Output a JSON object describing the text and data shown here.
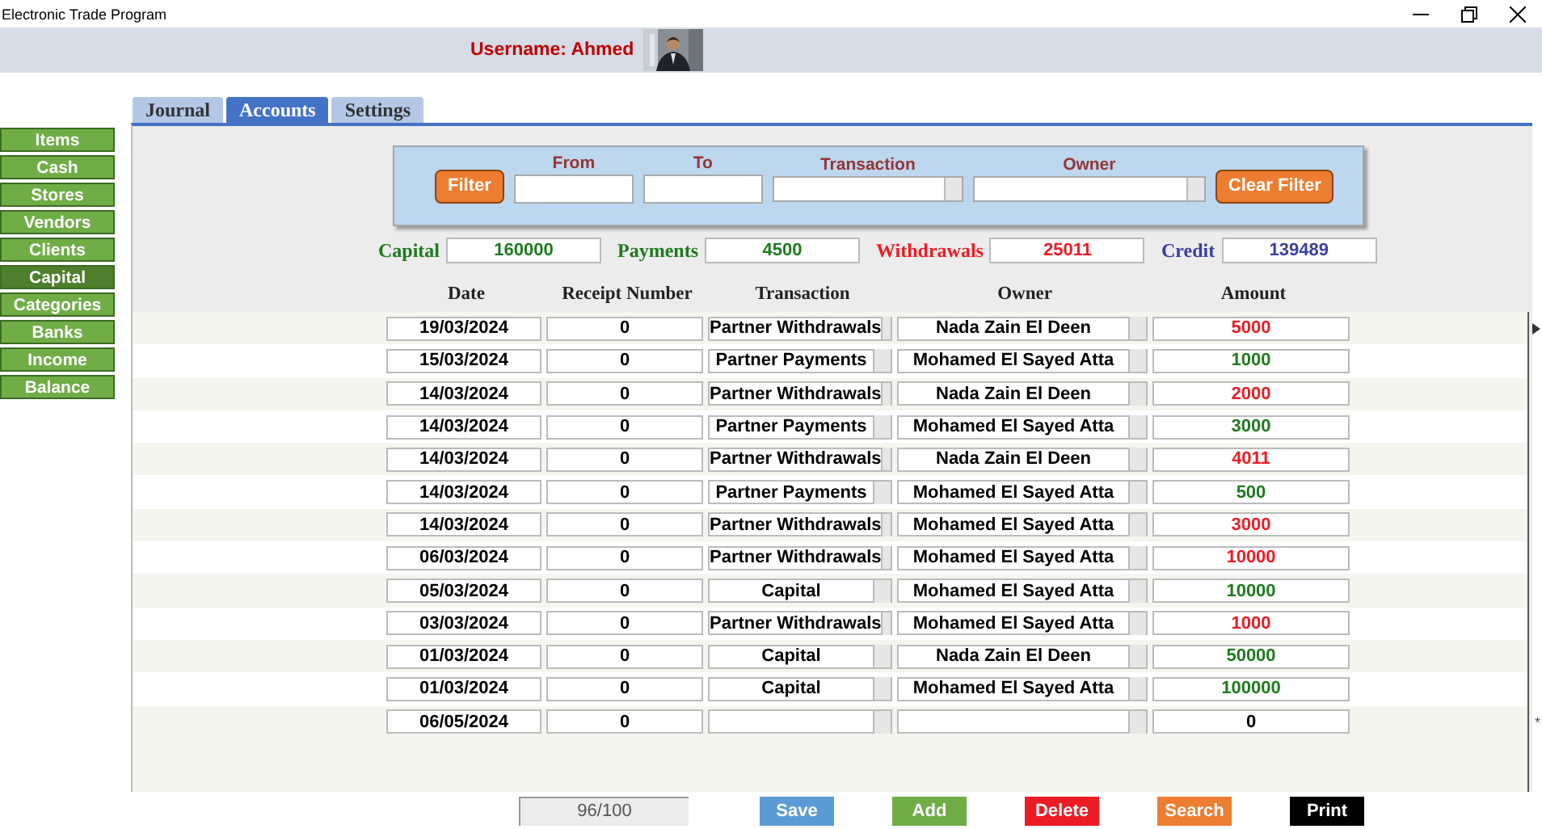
{
  "window": {
    "title": "Electronic Trade Program"
  },
  "header": {
    "username": "Username: Ahmed"
  },
  "sidebar": {
    "items": [
      {
        "label": "Items",
        "selected": false
      },
      {
        "label": "Cash",
        "selected": false
      },
      {
        "label": "Stores",
        "selected": false
      },
      {
        "label": "Vendors",
        "selected": false
      },
      {
        "label": "Clients",
        "selected": false
      },
      {
        "label": "Capital",
        "selected": true
      },
      {
        "label": "Categories",
        "selected": false
      },
      {
        "label": "Banks",
        "selected": false
      },
      {
        "label": "Income",
        "selected": false
      },
      {
        "label": "Balance",
        "selected": false
      }
    ]
  },
  "tabs": [
    {
      "label": "Journal",
      "selected": false
    },
    {
      "label": "Accounts",
      "selected": true
    },
    {
      "label": "Settings",
      "selected": false
    }
  ],
  "filter": {
    "filter_button": "Filter",
    "from_label": "From",
    "to_label": "To",
    "transaction_label": "Transaction",
    "owner_label": "Owner",
    "clear_button": "Clear Filter"
  },
  "summary": [
    {
      "label": "Capital",
      "value": "160000",
      "kind": "positive"
    },
    {
      "label": "Payments",
      "value": "4500",
      "kind": "positive"
    },
    {
      "label": "Withdrawals",
      "value": "25011",
      "kind": "negative"
    },
    {
      "label": "Credit",
      "value": "139489",
      "kind": "balance"
    }
  ],
  "table": {
    "columns": [
      "Date",
      "Receipt Number",
      "Transaction",
      "Owner",
      "Amount"
    ],
    "rows": [
      {
        "date": "19/03/2024",
        "receipt": "0",
        "transaction": "Partner Withdrawals",
        "owner": "Nada Zain El Deen",
        "amount": "5000",
        "kind": "withdrawal",
        "current": true
      },
      {
        "date": "15/03/2024",
        "receipt": "0",
        "transaction": "Partner Payments",
        "owner": "Mohamed El Sayed Atta",
        "amount": "1000",
        "kind": "deposit",
        "current": false
      },
      {
        "date": "14/03/2024",
        "receipt": "0",
        "transaction": "Partner Withdrawals",
        "owner": "Nada Zain El Deen",
        "amount": "2000",
        "kind": "withdrawal",
        "current": false
      },
      {
        "date": "14/03/2024",
        "receipt": "0",
        "transaction": "Partner Payments",
        "owner": "Mohamed El Sayed Atta",
        "amount": "3000",
        "kind": "deposit",
        "current": false
      },
      {
        "date": "14/03/2024",
        "receipt": "0",
        "transaction": "Partner Withdrawals",
        "owner": "Nada Zain El Deen",
        "amount": "4011",
        "kind": "withdrawal",
        "current": false
      },
      {
        "date": "14/03/2024",
        "receipt": "0",
        "transaction": "Partner Payments",
        "owner": "Mohamed El Sayed Atta",
        "amount": "500",
        "kind": "deposit",
        "current": false
      },
      {
        "date": "14/03/2024",
        "receipt": "0",
        "transaction": "Partner Withdrawals",
        "owner": "Mohamed El Sayed Atta",
        "amount": "3000",
        "kind": "withdrawal",
        "current": false
      },
      {
        "date": "06/03/2024",
        "receipt": "0",
        "transaction": "Partner Withdrawals",
        "owner": "Mohamed El Sayed Atta",
        "amount": "10000",
        "kind": "withdrawal",
        "current": false
      },
      {
        "date": "05/03/2024",
        "receipt": "0",
        "transaction": "Capital",
        "owner": "Mohamed El Sayed Atta",
        "amount": "10000",
        "kind": "deposit",
        "current": false
      },
      {
        "date": "03/03/2024",
        "receipt": "0",
        "transaction": "Partner Withdrawals",
        "owner": "Mohamed El Sayed Atta",
        "amount": "1000",
        "kind": "withdrawal",
        "current": false
      },
      {
        "date": "01/03/2024",
        "receipt": "0",
        "transaction": "Capital",
        "owner": "Nada Zain El Deen",
        "amount": "50000",
        "kind": "deposit",
        "current": false
      },
      {
        "date": "01/03/2024",
        "receipt": "0",
        "transaction": "Capital",
        "owner": "Mohamed El Sayed Atta",
        "amount": "100000",
        "kind": "deposit",
        "current": false
      },
      {
        "date": "06/05/2024",
        "receipt": "0",
        "amount": "0",
        "kind": "new",
        "current": false,
        "record_marker": "*"
      }
    ]
  },
  "footer": {
    "record_counter": "96/100",
    "buttons": [
      {
        "label": "Save",
        "color": "#5b9bd5"
      },
      {
        "label": "Add",
        "color": "#70ad47"
      },
      {
        "label": "Delete",
        "color": "#ed1c24"
      },
      {
        "label": "Search",
        "color": "#ed7d31"
      },
      {
        "label": "Print",
        "color": "#000000"
      }
    ]
  }
}
